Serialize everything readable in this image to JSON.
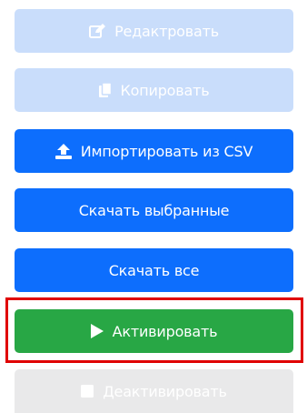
{
  "buttons": {
    "edit": {
      "label": "Редактровать",
      "icon": "edit-icon",
      "state": "disabled"
    },
    "copy": {
      "label": "Копировать",
      "icon": "copy-icon",
      "state": "disabled"
    },
    "import_csv": {
      "label": "Импортировать из CSV",
      "icon": "upload-icon",
      "state": "enabled"
    },
    "download_selected": {
      "label": "Скачать выбранные",
      "state": "enabled"
    },
    "download_all": {
      "label": "Скачать все",
      "state": "enabled"
    },
    "activate": {
      "label": "Активировать",
      "icon": "play-icon",
      "state": "enabled",
      "highlighted": true
    },
    "deactivate": {
      "label": "Деактивировать",
      "icon": "stop-icon",
      "state": "disabled"
    }
  },
  "colors": {
    "primary": "#0d6efd",
    "primary_disabled": "#c9ddfb",
    "success": "#28a745",
    "disabled": "#e9e9ea",
    "highlight": "#e00000"
  }
}
